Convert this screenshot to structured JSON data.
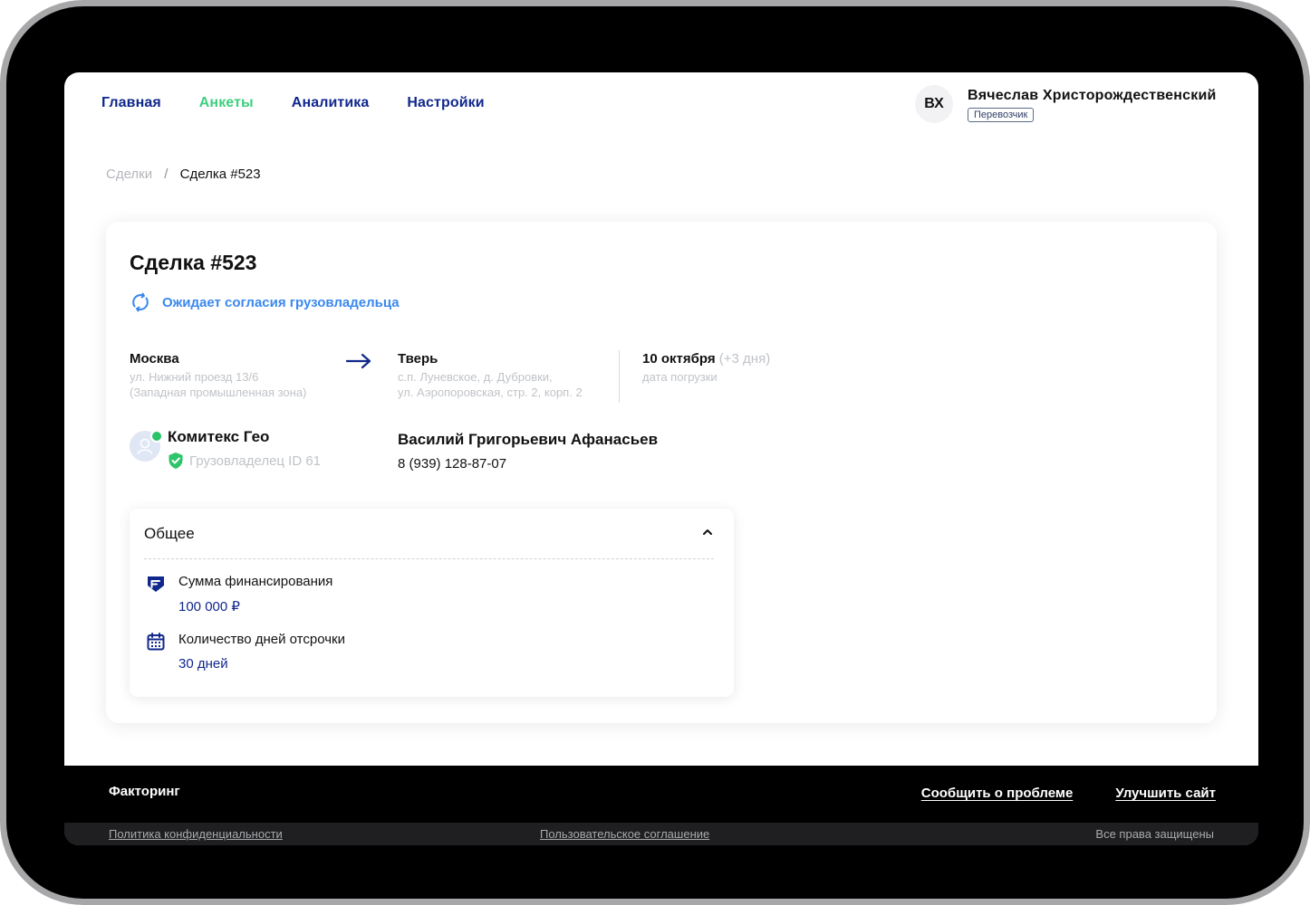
{
  "nav": {
    "items": [
      {
        "label": "Главная",
        "active": false
      },
      {
        "label": "Анкеты",
        "active": true
      },
      {
        "label": "Аналитика",
        "active": false
      },
      {
        "label": "Настройки",
        "active": false
      }
    ]
  },
  "user": {
    "initials": "ВХ",
    "name": "Вячеслав  Христорождественский",
    "role": "Перевозчик"
  },
  "breadcrumb": {
    "parent": "Сделки",
    "separator": "/",
    "current": "Сделка #523"
  },
  "deal": {
    "title": "Сделка #523",
    "status": "Ожидает согласия грузовладельца",
    "status_icon": "refresh-icon",
    "from": {
      "city": "Москва",
      "address_line1": "ул. Нижний проезд 13/6",
      "address_line2": "(Западная промышленная зона)"
    },
    "to": {
      "city": "Тверь",
      "address_line1": "с.п. Луневское, д. Дубровки,",
      "address_line2": "ул. Аэропоровская, стр. 2, корп. 2"
    },
    "loading": {
      "date": "10 октября",
      "extra": "(+3 дня)",
      "label": "дата погрузки"
    },
    "company": {
      "name": "Комитекс Гео",
      "owner_label": "Грузовладелец ID 61",
      "online": true
    },
    "contact": {
      "name": "Василий Григорьевич Афанасьев",
      "phone": "8 (939) 128-87-07"
    }
  },
  "general": {
    "title": "Общее",
    "items": [
      {
        "label": "Сумма финансирования",
        "value": "100 000 ₽",
        "icon": "finance-icon"
      },
      {
        "label": "Количество дней отсрочки",
        "value": "30 дней",
        "icon": "calendar-icon"
      }
    ]
  },
  "footer": {
    "brand": "Факторинг",
    "links": [
      "Сообщить о проблеме",
      "Улучшить сайт"
    ],
    "privacy": "Политика конфиденциальности",
    "agreement": "Пользовательское соглашение",
    "rights": "Все права защищены"
  },
  "colors": {
    "nav": "#10278c",
    "nav_active": "#3ecf7e",
    "status": "#3a88ee",
    "value": "#10278c",
    "online": "#29c36a"
  }
}
